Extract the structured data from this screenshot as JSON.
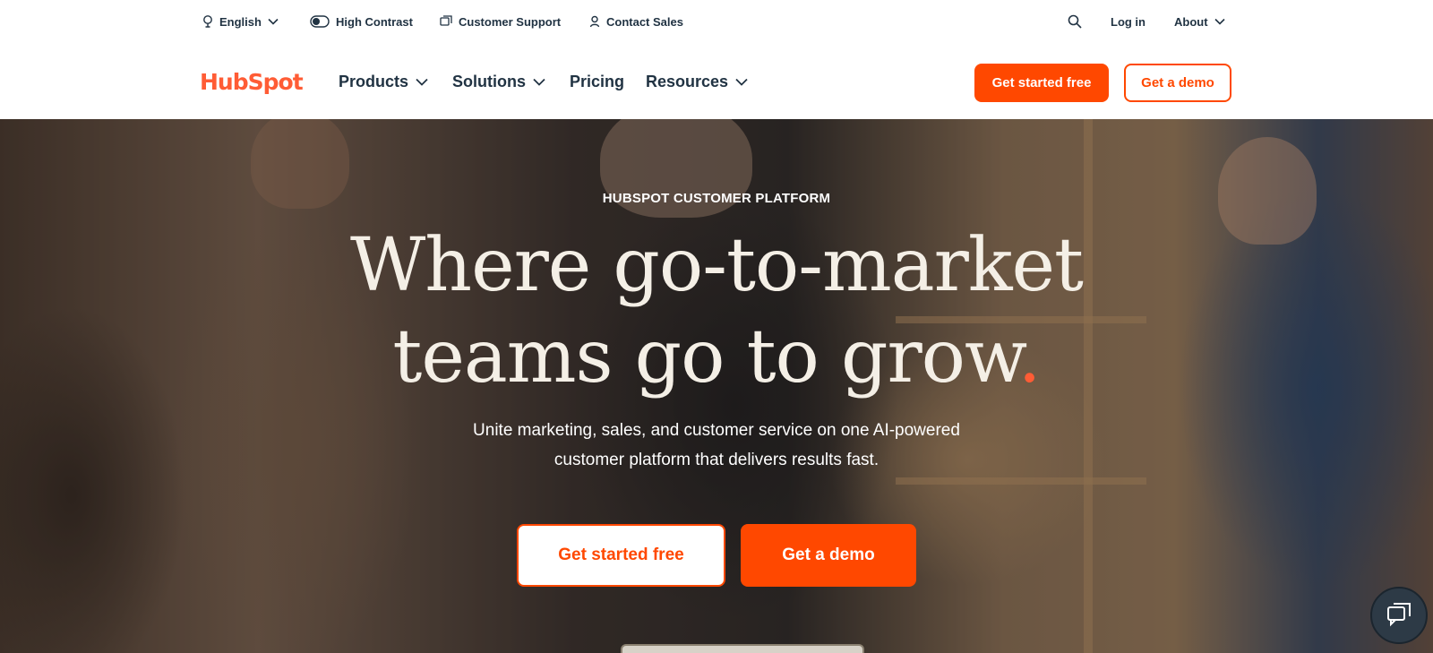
{
  "utility_bar": {
    "language": "English",
    "high_contrast": "High Contrast",
    "customer_support": "Customer Support",
    "contact_sales": "Contact Sales",
    "login": "Log in",
    "about": "About"
  },
  "nav": {
    "logo": "HubSpot",
    "products": "Products",
    "solutions": "Solutions",
    "pricing": "Pricing",
    "resources": "Resources",
    "get_started": "Get started free",
    "get_demo": "Get a demo"
  },
  "hero": {
    "eyebrow": "HUBSPOT CUSTOMER PLATFORM",
    "headline_line1": "Where go-to-market",
    "headline_line2": "teams go to grow",
    "headline_punct": ".",
    "subhead_line1": "Unite marketing, sales, and customer service on one AI-powered",
    "subhead_line2": "customer platform that delivers results fast.",
    "cta_primary": "Get started free",
    "cta_secondary": "Get a demo"
  },
  "colors": {
    "brand_orange": "#ff4800",
    "logo_orange": "#ff5c35",
    "text_dark": "#213343"
  },
  "icons": [
    "globe-icon",
    "contrast-toggle-icon",
    "support-chat-icon",
    "person-icon",
    "search-icon",
    "chevron-down-icon",
    "chat-launcher-icon"
  ]
}
